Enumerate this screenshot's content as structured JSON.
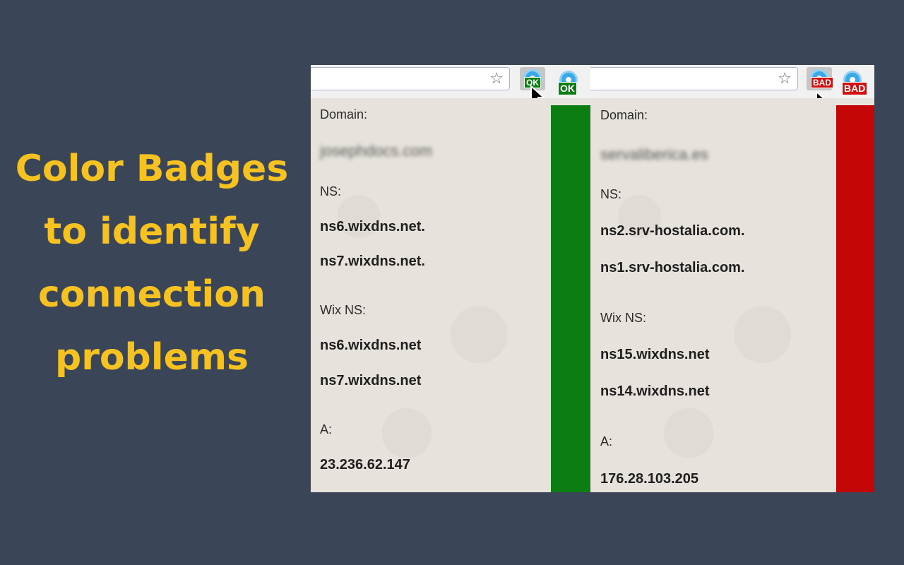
{
  "headline": {
    "lines": [
      "Color Badges",
      "to identify",
      "connection",
      "problems"
    ],
    "color": "#f5c221"
  },
  "panels": {
    "ok": {
      "badge": "OK",
      "badge_color": "#0b7d13",
      "status_color": "#0b7d13",
      "icons": [
        "star-icon",
        "extension-icon",
        "cursor-icon"
      ],
      "domain_label": "Domain:",
      "domain_value": "josephdocs.com",
      "ns_label": "NS:",
      "ns_values": [
        "ns6.wixdns.net.",
        "ns7.wixdns.net."
      ],
      "wix_ns_label": "Wix NS:",
      "wix_ns_values": [
        "ns6.wixdns.net",
        "ns7.wixdns.net"
      ],
      "a_label": "A:",
      "a_value": "23.236.62.147"
    },
    "bad": {
      "badge": "BAD",
      "badge_color": "#d10f0f",
      "status_color": "#c40606",
      "icons": [
        "star-icon",
        "extension-icon",
        "cursor-icon"
      ],
      "domain_label": "Domain:",
      "domain_value": "servaliberica.es",
      "ns_label": "NS:",
      "ns_values": [
        "ns2.srv-hostalia.com.",
        "ns1.srv-hostalia.com."
      ],
      "wix_ns_label": "Wix NS:",
      "wix_ns_values": [
        "ns15.wixdns.net",
        "ns14.wixdns.net"
      ],
      "a_label": "A:",
      "a_value": "176.28.103.205"
    }
  }
}
